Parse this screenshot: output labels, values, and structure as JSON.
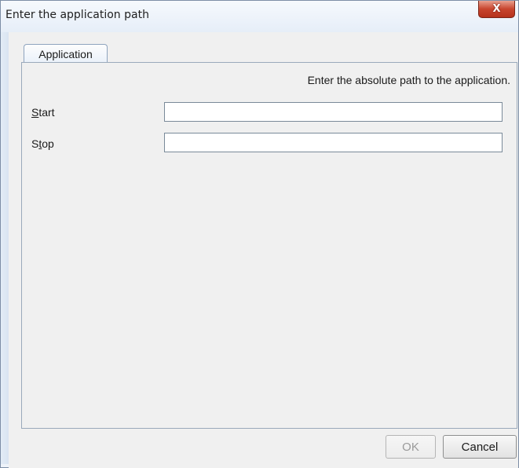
{
  "window": {
    "title": "Enter the application path",
    "close_glyph": "X"
  },
  "tabs": [
    {
      "label": "Application",
      "selected": true
    }
  ],
  "panel": {
    "hint": "Enter the absolute path to the application.",
    "fields": [
      {
        "mnemonic": "S",
        "label_rest": "tart",
        "value": ""
      },
      {
        "label_pre": "S",
        "mnemonic": "t",
        "label_rest": "op",
        "value": ""
      }
    ]
  },
  "buttons": {
    "ok": "OK",
    "ok_enabled": false,
    "cancel": "Cancel"
  },
  "colors": {
    "close_button": "#c8452e",
    "client_bg": "#f0f0f0",
    "frame": "#e3ecf6"
  }
}
